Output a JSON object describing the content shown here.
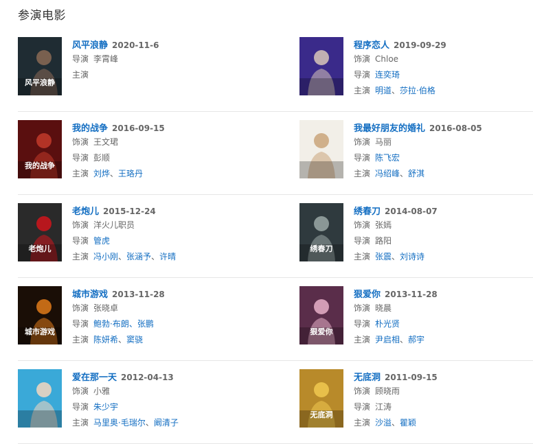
{
  "section_title": "参演电影",
  "labels": {
    "role": "饰演",
    "director": "导演",
    "cast": "主演"
  },
  "movies": [
    {
      "title": "风平浪静",
      "date": "2020-11-6",
      "role": null,
      "director": "李霄峰",
      "director_is_link": false,
      "cast": [],
      "poster": {
        "icon": "movie-poster-fengpinglangjing",
        "bg": "#1f2c33",
        "accent": "#8a6a55",
        "text": "风平浪静"
      }
    },
    {
      "title": "程序恋人",
      "date": "2019-09-29",
      "role": "Chloe",
      "director": "连奕琦",
      "director_is_link": true,
      "cast": [
        "明道",
        "莎拉·伯格"
      ],
      "poster": {
        "icon": "movie-poster-chengxulianren",
        "bg": "#3a2a8a",
        "accent": "#d9c7b8",
        "text": ""
      }
    },
    {
      "title": "我的战争",
      "date": "2016-09-15",
      "role": "王文珺",
      "director": "彭顺",
      "director_is_link": false,
      "cast": [
        "刘烨",
        "王珞丹"
      ],
      "poster": {
        "icon": "movie-poster-wodezhanzheng",
        "bg": "#5a0f0f",
        "accent": "#c23a2a",
        "text": "我的战争"
      }
    },
    {
      "title": "我最好朋友的婚礼",
      "date": "2016-08-05",
      "role": "马丽",
      "director": "陈飞宏",
      "director_is_link": true,
      "cast": [
        "冯绍峰",
        "舒淇"
      ],
      "poster": {
        "icon": "movie-poster-wozuihaopengyoudehunli",
        "bg": "#f2efe8",
        "accent": "#caa47a",
        "text": ""
      }
    },
    {
      "title": "老炮儿",
      "date": "2015-12-24",
      "role": "洋火儿职员",
      "director": "管虎",
      "director_is_link": true,
      "cast": [
        "冯小刚",
        "张涵予",
        "许晴"
      ],
      "poster": {
        "icon": "movie-poster-laopaoer",
        "bg": "#2a2a2a",
        "accent": "#d0141b",
        "text": "老炮儿"
      }
    },
    {
      "title": "绣春刀",
      "date": "2014-08-07",
      "role": "张嫣",
      "director": "路阳",
      "director_is_link": false,
      "cast": [
        "张震",
        "刘诗诗"
      ],
      "poster": {
        "icon": "movie-poster-xiuchundao",
        "bg": "#2f3a3e",
        "accent": "#9aa8a6",
        "text": "绣春刀"
      }
    },
    {
      "title": "城市游戏",
      "date": "2013-11-28",
      "role": "张晓卓",
      "director": "鲍勃·布朗、张鹏",
      "director_is_link": true,
      "cast": [
        "陈妍希",
        "窦骁"
      ],
      "poster": {
        "icon": "movie-poster-chengshiyouxi",
        "bg": "#1a0e06",
        "accent": "#e07a1a",
        "text": "城市游戏"
      }
    },
    {
      "title": "狠爱你",
      "date": "2013-11-28",
      "role": "晓晨",
      "director": "朴光贤",
      "director_is_link": true,
      "cast": [
        "尹启相",
        "郝宇"
      ],
      "poster": {
        "icon": "movie-poster-henaini",
        "bg": "#5a2d4a",
        "accent": "#e8b0c8",
        "text": "狠爱你"
      }
    },
    {
      "title": "爱在那一天",
      "date": "2012-04-13",
      "role": "小雅",
      "director": "朱少宇",
      "director_is_link": true,
      "cast": [
        "马里奥·毛瑞尔",
        "阚清子"
      ],
      "poster": {
        "icon": "movie-poster-aizainayitian",
        "bg": "#3aa9d8",
        "accent": "#f5d7c0",
        "text": ""
      }
    },
    {
      "title": "无底洞",
      "date": "2011-09-15",
      "role": "顾晓雨",
      "director": "江涛",
      "director_is_link": false,
      "cast": [
        "沙溢",
        "瞿颖"
      ],
      "poster": {
        "icon": "movie-poster-wudidong",
        "bg": "#b88a2a",
        "accent": "#f0c850",
        "text": "无底洞"
      }
    }
  ]
}
